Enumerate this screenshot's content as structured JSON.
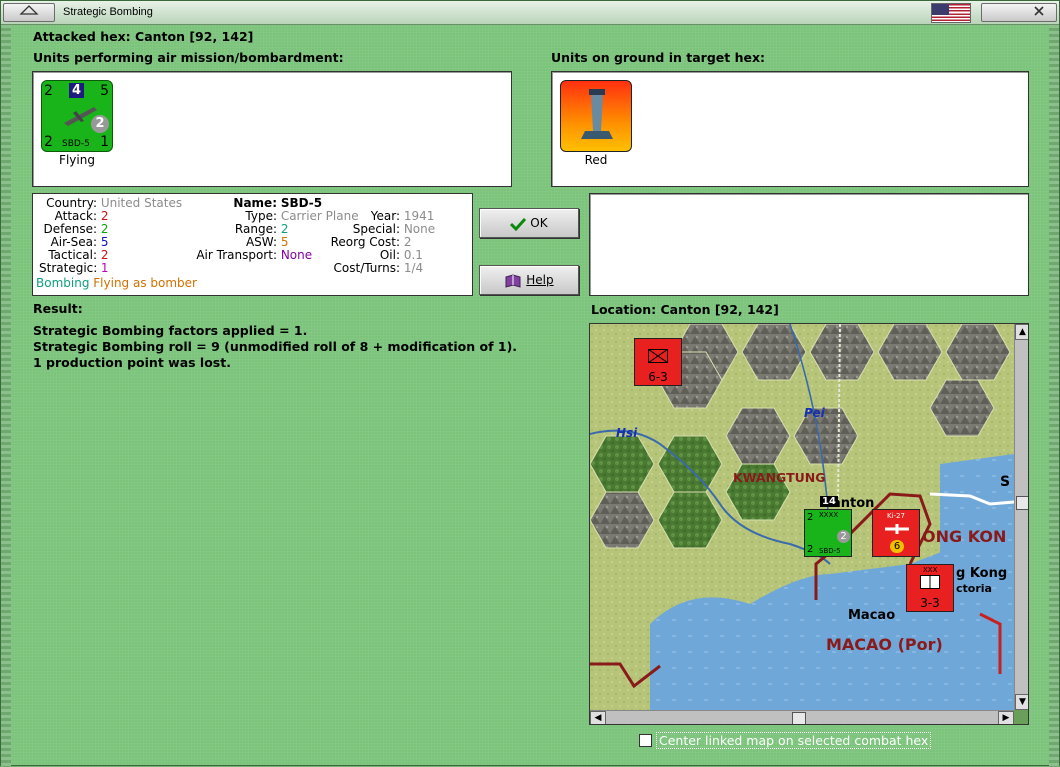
{
  "window": {
    "title": "Strategic Bombing"
  },
  "attacked_hex": "Attacked hex: Canton  [92, 142]",
  "air_units_label": "Units performing air mission/bombardment:",
  "ground_units_label": "Units on ground in target hex:",
  "air_unit": {
    "caption": "Flying",
    "attack": "2",
    "top_number": "4",
    "air_sea": "5",
    "defense": "2",
    "tactical_badge": "2",
    "strategic": "1",
    "name": "SBD-5"
  },
  "ground_unit": {
    "caption": "Red"
  },
  "details": {
    "country_label": "Country:",
    "country": "United States",
    "attack_label": "Attack:",
    "attack": "2",
    "defense_label": "Defense:",
    "defense": "2",
    "airsea_label": "Air-Sea:",
    "airsea": "5",
    "tactical_label": "Tactical:",
    "tactical": "2",
    "strategic_label": "Strategic:",
    "strategic": "1",
    "name_label": "Name:",
    "name": "SBD-5",
    "type_label": "Type:",
    "type": "Carrier Plane",
    "range_label": "Range:",
    "range": "2",
    "asw_label": "ASW:",
    "asw": "5",
    "air_transport_label": "Air Transport:",
    "air_transport": "None",
    "year_label": "Year:",
    "year": "1941",
    "special_label": "Special:",
    "special": "None",
    "reorg_label": "Reorg Cost:",
    "reorg": "2",
    "oil_label": "Oil:",
    "oil": "0.1",
    "cost_label": "Cost/Turns:",
    "cost": "1/4",
    "mission": "Bombing",
    "mission_status": "Flying as bomber"
  },
  "buttons": {
    "ok": "OK",
    "help": "Help"
  },
  "result": {
    "label": "Result:",
    "lines": [
      "Strategic Bombing factors applied = 1.",
      "Strategic Bombing roll = 9 (unmodified roll of 8 + modification of 1).",
      "1 production point was lost."
    ]
  },
  "location": "Location:  Canton  [92, 142]",
  "map": {
    "labels": {
      "hsi": "Hsi",
      "pei": "Pei",
      "kwangtung": "KWANGTUNG",
      "canton": "anton",
      "hongkong_region": "ONG KON",
      "hongkong_city": "g Kong",
      "victoria": "ctoria",
      "macao": "Macao",
      "macao_region": "MACAO (Por)",
      "s": "S"
    },
    "units": {
      "top_counter": "6-3",
      "mid_counter_value": "6",
      "bottom_counter": "3-3",
      "green_stack_count": "14",
      "green_attack": "2",
      "green_defense": "2",
      "green_name": "SBD-5",
      "green_badge": "2",
      "mid_counter_code": "Ki-27",
      "xxx": "XXX",
      "xxxx": "XXXX"
    }
  },
  "center_linked": "Center linked map on selected combat hex",
  "colors": {
    "background": "#7cc47c",
    "red_value": "#d01010",
    "green_value": "#10a010",
    "blue_value": "#1010c0",
    "magenta_value": "#c000c0",
    "gray_value": "#8c8c8c",
    "orange_value": "#d07000",
    "purple_value": "#8000a0",
    "teal_value": "#10a080"
  }
}
